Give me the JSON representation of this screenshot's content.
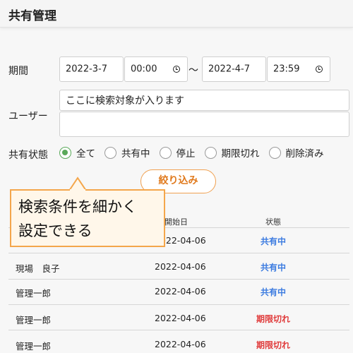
{
  "header": {
    "title": "共有管理"
  },
  "filters": {
    "period_label": "期間",
    "start_date": "2022-3-7",
    "start_time": "00:00",
    "separator": "～",
    "end_date": "2022-4-7",
    "end_time": "23:59",
    "user_label": "ユーザー",
    "user_value": "ここに検索対象が入ります",
    "status_label": "共有状態",
    "status_options": [
      "全て",
      "共有中",
      "停止",
      "期限切れ",
      "削除済み"
    ],
    "status_selected": "全て",
    "filter_button": "絞り込み"
  },
  "table": {
    "headers": [
      "開始日",
      "状態"
    ],
    "rows": [
      {
        "user": "",
        "date": "2022-04-06",
        "status": "共有中"
      },
      {
        "user": "現場　良子",
        "date": "2022-04-06",
        "status": "共有中"
      },
      {
        "user": "管理一郎",
        "date": "2022-04-06",
        "status": "共有中"
      },
      {
        "user": "管理一郎",
        "date": "2022-04-06",
        "status": "期限切れ"
      },
      {
        "user": "管理一郎",
        "date": "2022-04-06",
        "status": "期限切れ"
      }
    ]
  },
  "callout": {
    "text": "検索条件を細かく\n設定できる"
  },
  "colors": {
    "accent_green": "#5aa95a",
    "accent_orange": "#f0a050",
    "status_active": "#3b7be0",
    "status_expired": "#e03b3b"
  }
}
